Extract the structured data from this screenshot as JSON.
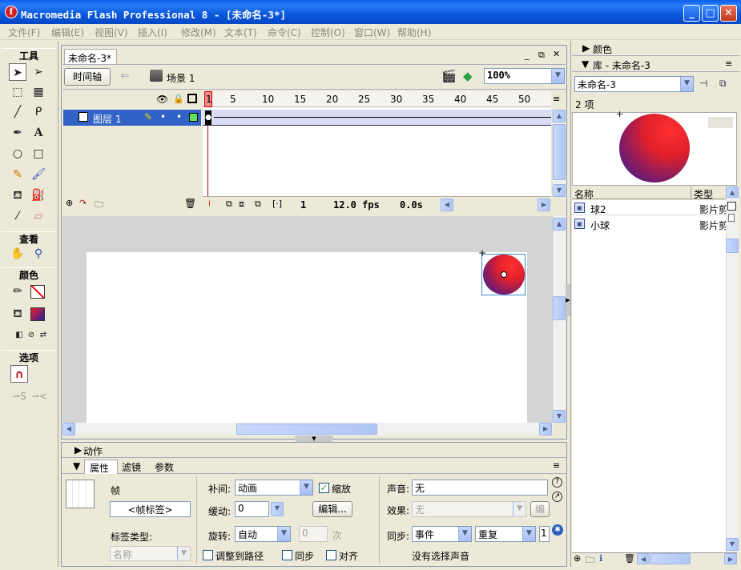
{
  "window": {
    "title": "Macromedia Flash Professional 8 - [未命名-3*]"
  },
  "menu": [
    "文件(F)",
    "编辑(E)",
    "视图(V)",
    "插入(I)",
    "修改(M)",
    "文本(T)",
    "命令(C)",
    "控制(O)",
    "窗口(W)",
    "帮助(H)"
  ],
  "tools": {
    "header": "工具",
    "view_header": "查看",
    "color_header": "颜色",
    "options_header": "选项"
  },
  "document": {
    "tab": "未命名-3*",
    "timeline_button": "时间轴",
    "scene": "场景 1",
    "zoom": "100%"
  },
  "timeline": {
    "layer_name": "图层 1",
    "ruler": [
      "1",
      "5",
      "10",
      "15",
      "20",
      "25",
      "30",
      "35",
      "40",
      "45",
      "50"
    ],
    "current_frame": "1",
    "fps": "12.0 fps",
    "elapsed": "0.0s"
  },
  "panels": {
    "actions": "动作",
    "tabs": [
      "属性",
      "滤镜",
      "参数"
    ]
  },
  "properties": {
    "frame_label": "帧",
    "frame_label_input": "<帧标签>",
    "label_type": "标签类型:",
    "label_type_value": "名称",
    "tween_label": "补间:",
    "tween_value": "动画",
    "scale_label": "缩放",
    "ease_label": "缓动:",
    "ease_value": "0",
    "edit_button": "编辑...",
    "rotate_label": "旋转:",
    "rotate_value": "自动",
    "rotate_times": "0",
    "times_unit": "次",
    "orient_path": "调整到路径",
    "sync": "同步",
    "snap": "对齐",
    "sound_label": "声音:",
    "sound_value": "无",
    "effect_label": "效果:",
    "effect_value": "无",
    "effect_edit": "编辑",
    "sync_label": "同步:",
    "sync_value": "事件",
    "repeat_value": "重复",
    "repeat_count": "1",
    "no_sound": "没有选择声音"
  },
  "right_panels": {
    "color": "颜色",
    "library_title": "库 - 未命名-3",
    "library_select": "未命名-3",
    "item_count": "2 项",
    "col_name": "名称",
    "col_type": "类型",
    "items": [
      {
        "name": "球2",
        "type": "影片剪"
      },
      {
        "name": "小球",
        "type": "影片剪"
      }
    ]
  },
  "colors": {
    "titlebar": "#0a58dc",
    "selection": "#3163c6",
    "ball_light": "#ff2a2a",
    "ball_dark": "#2a1f9a"
  }
}
